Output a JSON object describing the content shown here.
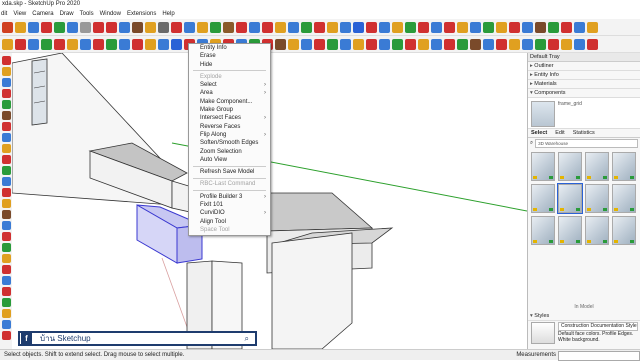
{
  "window": {
    "title": "xda.skp - SketchUp Pro 2020"
  },
  "menu": [
    "dit",
    "View",
    "Camera",
    "Draw",
    "Tools",
    "Window",
    "Extensions",
    "Help"
  ],
  "context_menu": {
    "items": [
      {
        "label": "Entity Info",
        "enabled": true,
        "submenu": false
      },
      {
        "label": "Erase",
        "enabled": true,
        "submenu": false
      },
      {
        "label": "Hide",
        "enabled": true,
        "submenu": false
      },
      {
        "sep": true
      },
      {
        "label": "Explode",
        "enabled": false,
        "submenu": false
      },
      {
        "label": "Select",
        "enabled": true,
        "submenu": true
      },
      {
        "label": "Area",
        "enabled": true,
        "submenu": true
      },
      {
        "label": "Make Component...",
        "enabled": true,
        "submenu": false
      },
      {
        "label": "Make Group",
        "enabled": true,
        "submenu": false
      },
      {
        "label": "Intersect Faces",
        "enabled": true,
        "submenu": true
      },
      {
        "label": "Reverse Faces",
        "enabled": true,
        "submenu": false
      },
      {
        "label": "Flip Along",
        "enabled": true,
        "submenu": true
      },
      {
        "label": "Soften/Smooth Edges",
        "enabled": true,
        "submenu": false
      },
      {
        "label": "Zoom Selection",
        "enabled": true,
        "submenu": false
      },
      {
        "label": "Auto View",
        "enabled": true,
        "submenu": false
      },
      {
        "sep": true
      },
      {
        "label": "Refresh Save Model",
        "enabled": true,
        "submenu": false
      },
      {
        "sep": true
      },
      {
        "label": "RBC-Last Command",
        "enabled": false,
        "submenu": false
      },
      {
        "sep": true
      },
      {
        "label": "Profile Builder 3",
        "enabled": true,
        "submenu": true
      },
      {
        "label": "FixIt 101",
        "enabled": true,
        "submenu": false
      },
      {
        "label": "CurviDIO",
        "enabled": true,
        "submenu": true
      },
      {
        "label": "Align Tool",
        "enabled": true,
        "submenu": false
      },
      {
        "label": "Space Tool",
        "enabled": false,
        "submenu": false
      }
    ]
  },
  "tray": {
    "title": "Default Tray",
    "sections": [
      "Outliner",
      "Entity Info",
      "Materials",
      "Components"
    ],
    "component_name": "frame_grid",
    "tabs": [
      "Select",
      "Edit",
      "Statistics"
    ],
    "search_placeholder": "3D Warehouse",
    "model_label": "In Model",
    "styles_label": "Styles",
    "style_name": "Construction Documentation Style",
    "style_desc": "Default face colors. Profile Edges. White background."
  },
  "status": {
    "text": "Select objects. Shift to extend select. Drag mouse to select multiple.",
    "measurements_label": "Measurements"
  },
  "overlay": {
    "facebook_text": "บ้าน Sketchup"
  },
  "toolbar_colors": {
    "row1": [
      "#d04020",
      "#e0a020",
      "#3a7bd5",
      "#d03030",
      "#2a9b3a",
      "#3a7bd5",
      "#999999",
      "#d03030",
      "#d03030",
      "#3a7bd5",
      "#7a4a2a",
      "#e0a020",
      "#6a6a6a",
      "#d03030",
      "#3a7bd5",
      "#e0a020",
      "#2a9b3a",
      "#8a5a2a",
      "#d03030",
      "#3a7bd5",
      "#d03030",
      "#e0a020",
      "#3a7bd5",
      "#2a9b3a",
      "#d03030",
      "#e0a020",
      "#3a7bd5",
      "#2a62d6",
      "#d03030",
      "#3a7bd5",
      "#e0a020",
      "#2a9b3a",
      "#d03030",
      "#3a7bd5",
      "#d03030",
      "#e0a020",
      "#3a7bd5",
      "#2a9b3a",
      "#e0a020",
      "#d03030",
      "#3a7bd5",
      "#7a4a2a",
      "#2a9b3a",
      "#d03030",
      "#3a7bd5",
      "#e0a020"
    ],
    "row2": [
      "#e0a020",
      "#d03030",
      "#3a7bd5",
      "#2a9b3a",
      "#d03030",
      "#e0a020",
      "#3a7bd5",
      "#d03030",
      "#2a9b3a",
      "#3a7bd5",
      "#d03030",
      "#e0a020",
      "#3a7bd5",
      "#2a62d6",
      "#d03030",
      "#3a7bd5",
      "#e0a020",
      "#d03030",
      "#3a7bd5",
      "#2a9b3a",
      "#d03030",
      "#7a4a2a",
      "#e0a020",
      "#3a7bd5",
      "#d03030",
      "#2a9b3a",
      "#3a7bd5",
      "#e0a020",
      "#d03030",
      "#3a7bd5",
      "#2a9b3a",
      "#d03030",
      "#e0a020",
      "#3a7bd5",
      "#d03030",
      "#2a9b3a",
      "#7a4a2a",
      "#3a7bd5",
      "#d03030",
      "#e0a020",
      "#3a7bd5",
      "#2a9b3a",
      "#d03030",
      "#e0a020",
      "#3a7bd5",
      "#d03030"
    ],
    "left": [
      "#d03030",
      "#e0a020",
      "#3a7bd5",
      "#d03030",
      "#2a9b3a",
      "#7a4a2a",
      "#d03030",
      "#3a7bd5",
      "#e0a020",
      "#d03030",
      "#2a9b3a",
      "#3a7bd5",
      "#d03030",
      "#e0a020",
      "#7a4a2a",
      "#3a7bd5",
      "#d03030",
      "#2a9b3a",
      "#e0a020",
      "#d03030",
      "#3a7bd5",
      "#d03030",
      "#2a9b3a",
      "#e0a020",
      "#3a7bd5",
      "#d03030"
    ]
  }
}
